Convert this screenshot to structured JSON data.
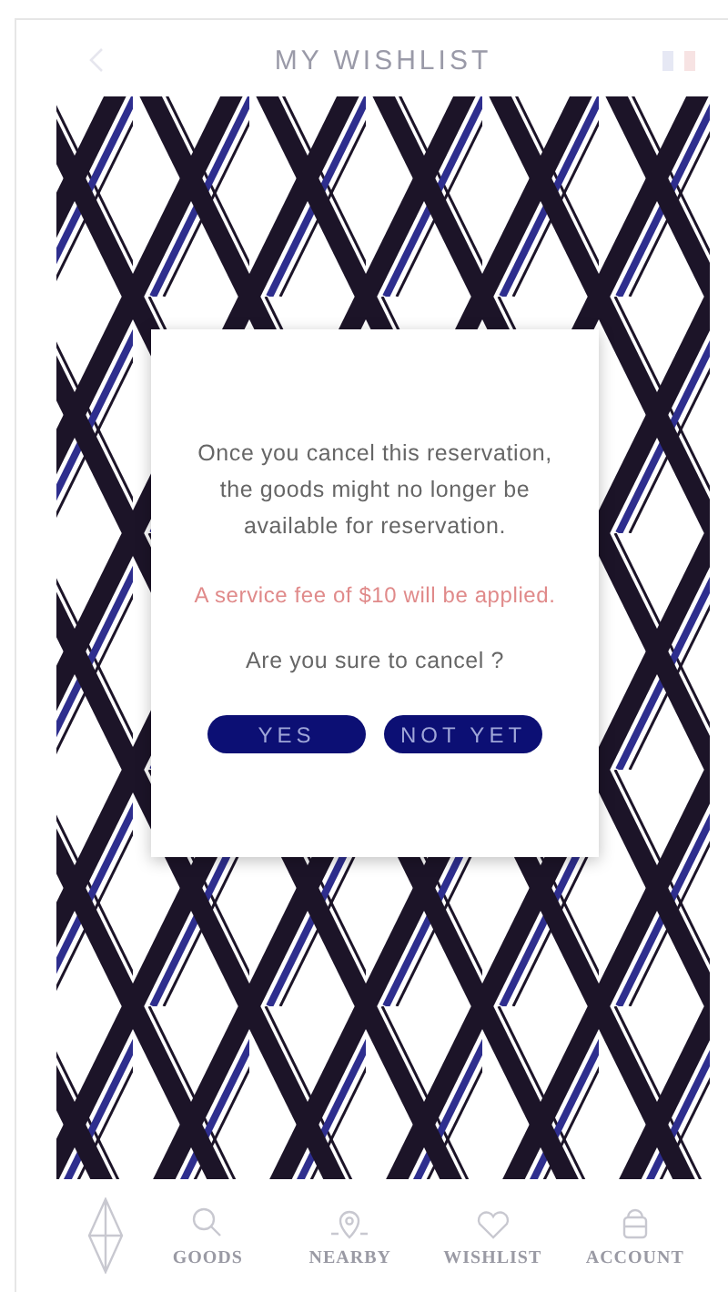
{
  "header": {
    "title": "MY WISHLIST"
  },
  "dialog": {
    "message": "Once you cancel this reservation, the goods might no longer be available for reservation.",
    "fee_notice": "A service fee of $10 will be applied.",
    "question": "Are you sure to cancel ?",
    "buttons": [
      {
        "label": "YES"
      },
      {
        "label": "NOT YET"
      }
    ]
  },
  "bottom_nav": [
    {
      "kind": "search",
      "label": "GOODS"
    },
    {
      "kind": "pin",
      "label": "NEARBY"
    },
    {
      "kind": "heart",
      "label": "WISHLIST"
    },
    {
      "kind": "bag",
      "label": "ACCOUNT"
    }
  ]
}
